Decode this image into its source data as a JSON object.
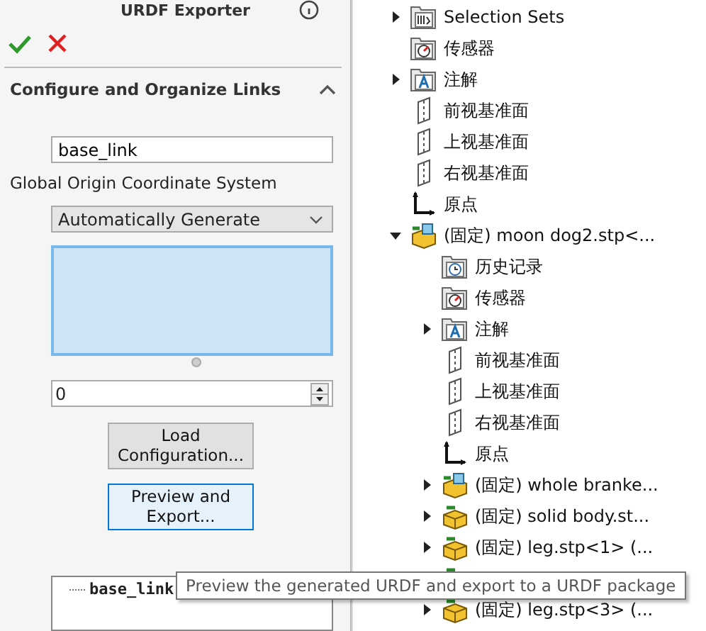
{
  "panel": {
    "title": "URDF Exporter",
    "section": {
      "title": "Configure and Organize Links",
      "expanded": true
    },
    "link_name": {
      "value": "base_link"
    },
    "origin_label": "Global Origin Coordinate System",
    "origin_dropdown": {
      "value": "Automatically Generate"
    },
    "spin": {
      "value": "0"
    },
    "buttons": [
      {
        "label": "Load Configuration...",
        "focused": false
      },
      {
        "label": "Preview and Export...",
        "focused": true
      }
    ],
    "link_tree": [
      {
        "label": "base_link"
      }
    ],
    "tooltip": "Preview the generated URDF and export to a URDF package"
  },
  "tree": [
    {
      "label": "Selection Sets",
      "kind": "sets",
      "expandable": true,
      "expanded": false
    },
    {
      "label": "传感器",
      "kind": "sensor",
      "expandable": false
    },
    {
      "label": "注解",
      "kind": "annotation",
      "expandable": true,
      "expanded": false
    },
    {
      "label": "前视基准面",
      "kind": "plane",
      "expandable": false
    },
    {
      "label": "上视基准面",
      "kind": "plane",
      "expandable": false
    },
    {
      "label": "右视基准面",
      "kind": "plane",
      "expandable": false
    },
    {
      "label": "原点",
      "kind": "origin",
      "expandable": false
    },
    {
      "label": "(固定) moon dog2.stp<...",
      "kind": "assembly",
      "expandable": true,
      "expanded": true,
      "children": [
        {
          "label": "历史记录",
          "kind": "history",
          "expandable": false
        },
        {
          "label": "传感器",
          "kind": "sensor",
          "expandable": false
        },
        {
          "label": "注解",
          "kind": "annotation",
          "expandable": true,
          "expanded": false
        },
        {
          "label": "前视基准面",
          "kind": "plane",
          "expandable": false
        },
        {
          "label": "上视基准面",
          "kind": "plane",
          "expandable": false
        },
        {
          "label": "右视基准面",
          "kind": "plane",
          "expandable": false
        },
        {
          "label": "原点",
          "kind": "origin",
          "expandable": false
        },
        {
          "label": "(固定) whole branke...",
          "kind": "subassembly",
          "expandable": true,
          "expanded": false
        },
        {
          "label": "(固定) solid body.st...",
          "kind": "part",
          "expandable": true,
          "expanded": false
        },
        {
          "label": "(固定) leg.stp<1> (...",
          "kind": "part",
          "expandable": true,
          "expanded": false
        },
        {
          "kind": "part"
        },
        {
          "label": "(固定) leg.stp<3> (...",
          "kind": "part",
          "expandable": true,
          "expanded": false
        }
      ]
    }
  ]
}
